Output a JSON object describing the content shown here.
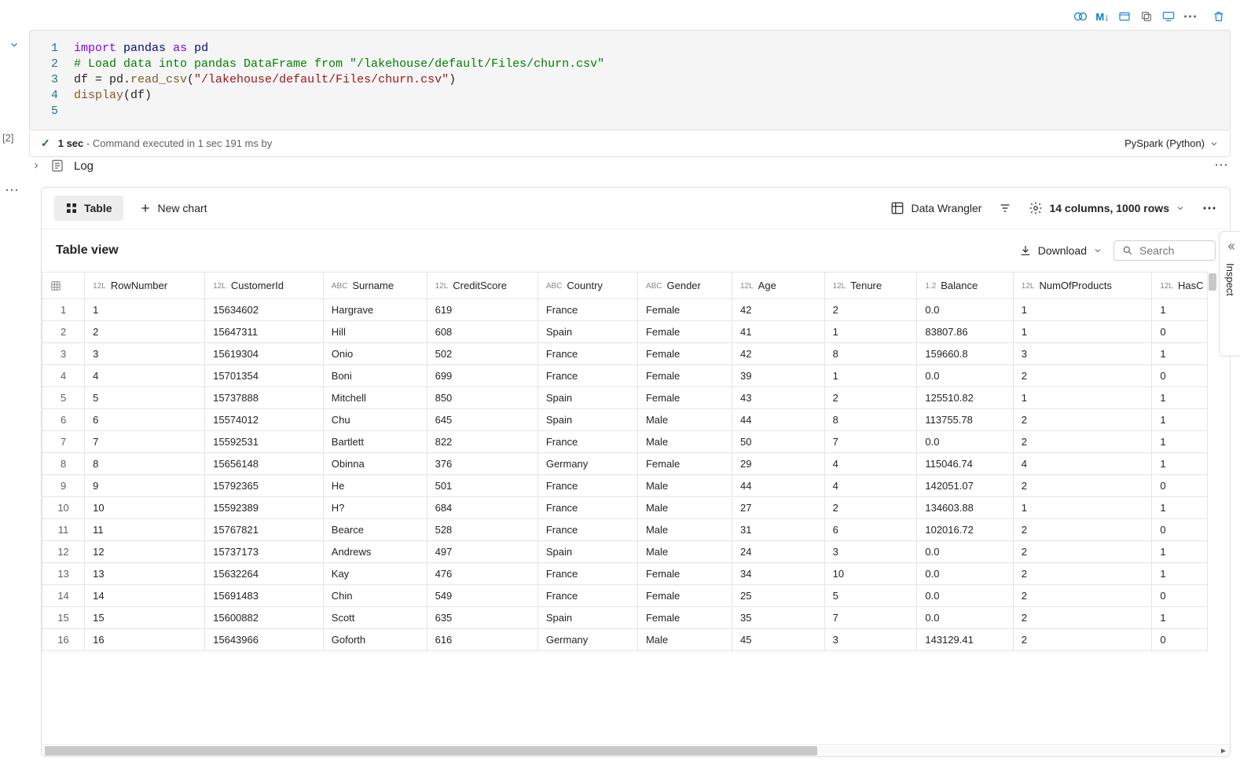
{
  "cell": {
    "exec_label": "[2]",
    "code_lines_raw": [
      "import pandas as pd",
      "# Load data into pandas DataFrame from \"/lakehouse/default/Files/churn.csv\"",
      "df = pd.read_csv(\"/lakehouse/default/Files/churn.csv\")",
      "display(df)",
      ""
    ],
    "status": {
      "duration": "1 sec",
      "detail_prefix": "Command executed in",
      "detail_time": "1 sec 191 ms",
      "detail_by": "by"
    },
    "kernel": "PySpark (Python)"
  },
  "log": {
    "label": "Log"
  },
  "output": {
    "tabs": {
      "table": "Table",
      "new_chart": "New chart"
    },
    "data_wrangler": "Data Wrangler",
    "col_summary": "14 columns, 1000 rows",
    "view_title": "Table view",
    "download": "Download",
    "search_placeholder": "Search",
    "inspect": "Inspect",
    "columns": [
      {
        "type": "12L",
        "name": "RowNumber"
      },
      {
        "type": "12L",
        "name": "CustomerId"
      },
      {
        "type": "ABC",
        "name": "Surname"
      },
      {
        "type": "12L",
        "name": "CreditScore"
      },
      {
        "type": "ABC",
        "name": "Country"
      },
      {
        "type": "ABC",
        "name": "Gender"
      },
      {
        "type": "12L",
        "name": "Age"
      },
      {
        "type": "12L",
        "name": "Tenure"
      },
      {
        "type": "1.2",
        "name": "Balance"
      },
      {
        "type": "12L",
        "name": "NumOfProducts"
      },
      {
        "type": "12L",
        "name": "HasC"
      }
    ],
    "rows": [
      [
        "1",
        "1",
        "15634602",
        "Hargrave",
        "619",
        "France",
        "Female",
        "42",
        "2",
        "0.0",
        "1",
        "1"
      ],
      [
        "2",
        "2",
        "15647311",
        "Hill",
        "608",
        "Spain",
        "Female",
        "41",
        "1",
        "83807.86",
        "1",
        "0"
      ],
      [
        "3",
        "3",
        "15619304",
        "Onio",
        "502",
        "France",
        "Female",
        "42",
        "8",
        "159660.8",
        "3",
        "1"
      ],
      [
        "4",
        "4",
        "15701354",
        "Boni",
        "699",
        "France",
        "Female",
        "39",
        "1",
        "0.0",
        "2",
        "0"
      ],
      [
        "5",
        "5",
        "15737888",
        "Mitchell",
        "850",
        "Spain",
        "Female",
        "43",
        "2",
        "125510.82",
        "1",
        "1"
      ],
      [
        "6",
        "6",
        "15574012",
        "Chu",
        "645",
        "Spain",
        "Male",
        "44",
        "8",
        "113755.78",
        "2",
        "1"
      ],
      [
        "7",
        "7",
        "15592531",
        "Bartlett",
        "822",
        "France",
        "Male",
        "50",
        "7",
        "0.0",
        "2",
        "1"
      ],
      [
        "8",
        "8",
        "15656148",
        "Obinna",
        "376",
        "Germany",
        "Female",
        "29",
        "4",
        "115046.74",
        "4",
        "1"
      ],
      [
        "9",
        "9",
        "15792365",
        "He",
        "501",
        "France",
        "Male",
        "44",
        "4",
        "142051.07",
        "2",
        "0"
      ],
      [
        "10",
        "10",
        "15592389",
        "H?",
        "684",
        "France",
        "Male",
        "27",
        "2",
        "134603.88",
        "1",
        "1"
      ],
      [
        "11",
        "11",
        "15767821",
        "Bearce",
        "528",
        "France",
        "Male",
        "31",
        "6",
        "102016.72",
        "2",
        "0"
      ],
      [
        "12",
        "12",
        "15737173",
        "Andrews",
        "497",
        "Spain",
        "Male",
        "24",
        "3",
        "0.0",
        "2",
        "1"
      ],
      [
        "13",
        "13",
        "15632264",
        "Kay",
        "476",
        "France",
        "Female",
        "34",
        "10",
        "0.0",
        "2",
        "1"
      ],
      [
        "14",
        "14",
        "15691483",
        "Chin",
        "549",
        "France",
        "Female",
        "25",
        "5",
        "0.0",
        "2",
        "0"
      ],
      [
        "15",
        "15",
        "15600882",
        "Scott",
        "635",
        "Spain",
        "Female",
        "35",
        "7",
        "0.0",
        "2",
        "1"
      ],
      [
        "16",
        "16",
        "15643966",
        "Goforth",
        "616",
        "Germany",
        "Male",
        "45",
        "3",
        "143129.41",
        "2",
        "0"
      ]
    ]
  },
  "toolbar_top": {
    "markdown": "M↓"
  }
}
